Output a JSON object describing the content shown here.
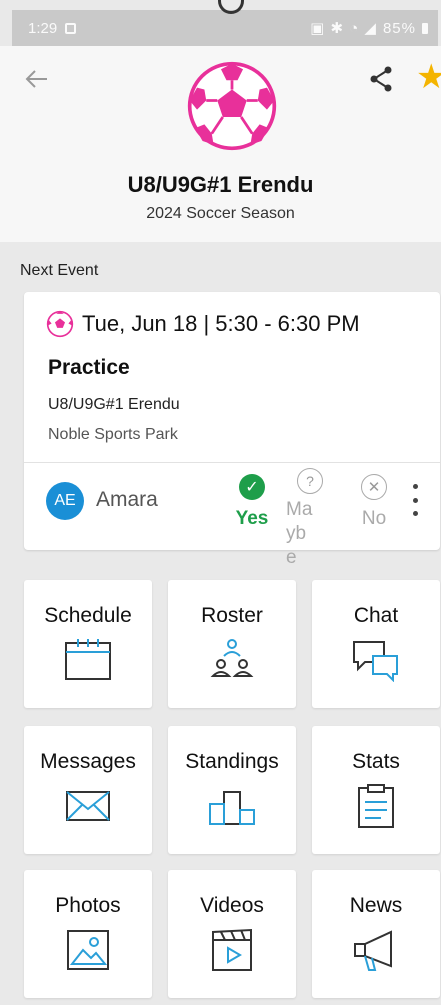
{
  "status_bar": {
    "time": "1:29",
    "battery": "85%"
  },
  "header": {
    "team_name": "U8/U9G#1 Erendu",
    "season": "2024 Soccer Season"
  },
  "next_event": {
    "section_title": "Next Event",
    "date_time": "Tue, Jun 18 | 5:30 - 6:30 PM",
    "type": "Practice",
    "team": "U8/U9G#1 Erendu",
    "location": "Noble Sports Park",
    "attendee": {
      "initials": "AE",
      "name": "Amara"
    },
    "rsvp": {
      "yes": "Yes",
      "maybe": "Maybe",
      "no": "No",
      "selected": "yes"
    }
  },
  "tiles": [
    {
      "label": "Schedule",
      "icon": "calendar-icon"
    },
    {
      "label": "Roster",
      "icon": "team-icon"
    },
    {
      "label": "Chat",
      "icon": "chat-bubbles-icon"
    },
    {
      "label": "Messages",
      "icon": "envelope-icon"
    },
    {
      "label": "Standings",
      "icon": "podium-icon"
    },
    {
      "label": "Stats",
      "icon": "clipboard-icon"
    },
    {
      "label": "Photos",
      "icon": "photo-icon"
    },
    {
      "label": "Videos",
      "icon": "video-clapper-icon"
    },
    {
      "label": "News",
      "icon": "megaphone-icon"
    }
  ],
  "colors": {
    "accent": "#1a8fd6",
    "yes": "#1e9e4a",
    "ball": "#e8309a",
    "star": "#f4b400",
    "icon_line": "#2a9fd8"
  }
}
